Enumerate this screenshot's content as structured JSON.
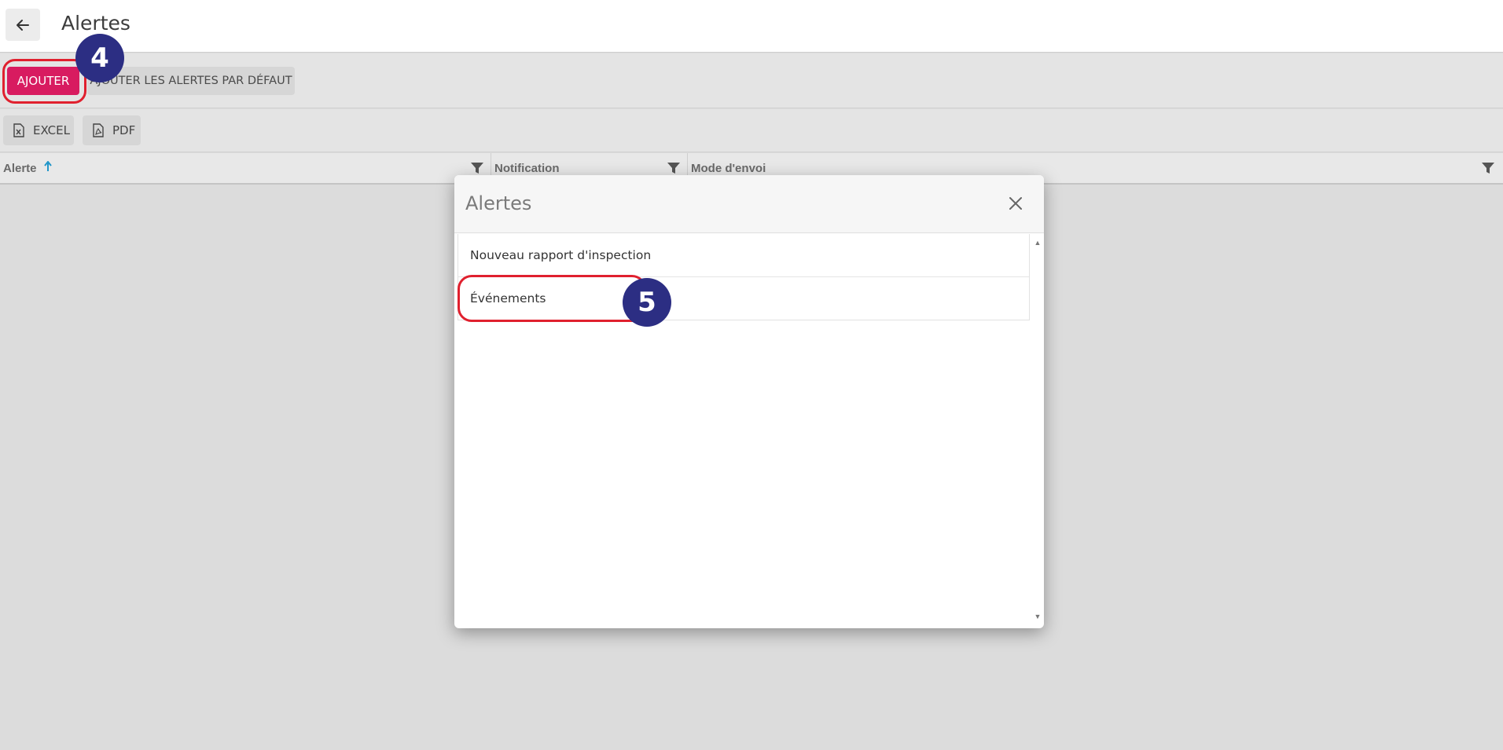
{
  "header": {
    "title": "Alertes",
    "back_icon": "arrow-left-icon"
  },
  "toolbar": {
    "add_label": "AJOUTER",
    "add_default_label": "AJOUTER LES ALERTES PAR DÉFAUT",
    "add_color": "#d81b60"
  },
  "export": {
    "excel_label": "EXCEL",
    "pdf_label": "PDF"
  },
  "grid": {
    "columns": [
      {
        "label": "Alerte",
        "sorted": "ascending"
      },
      {
        "label": "Notification"
      },
      {
        "label": "Mode d'envoi"
      }
    ]
  },
  "modal": {
    "title": "Alertes",
    "items": [
      {
        "label": "Nouveau rapport d'inspection"
      },
      {
        "label": "Événements"
      }
    ]
  },
  "annotations": {
    "step_a": "4",
    "step_b": "5",
    "badge_color": "#2c2e83",
    "highlight_color": "#e0202e"
  }
}
